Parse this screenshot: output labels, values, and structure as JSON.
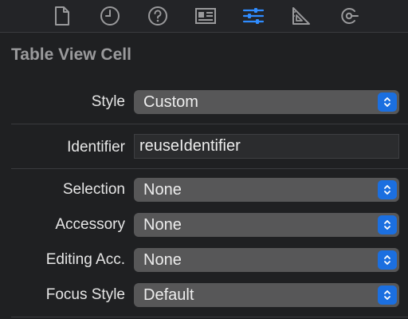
{
  "toolbar": {
    "icons": [
      {
        "name": "file-inspector-icon",
        "selected": false
      },
      {
        "name": "history-inspector-icon",
        "selected": false
      },
      {
        "name": "quick-help-icon",
        "selected": false
      },
      {
        "name": "identity-inspector-icon",
        "selected": false
      },
      {
        "name": "attributes-inspector-icon",
        "selected": true
      },
      {
        "name": "size-inspector-icon",
        "selected": false
      },
      {
        "name": "connections-inspector-icon",
        "selected": false
      }
    ],
    "accent_color": "#2f8cff"
  },
  "section": {
    "title": "Table View Cell"
  },
  "fields": {
    "style": {
      "label": "Style",
      "value": "Custom"
    },
    "identifier": {
      "label": "Identifier",
      "value": "reuseIdentifier"
    },
    "selection": {
      "label": "Selection",
      "value": "None"
    },
    "accessory": {
      "label": "Accessory",
      "value": "None"
    },
    "editing_acc": {
      "label": "Editing Acc.",
      "value": "None"
    },
    "focus_style": {
      "label": "Focus Style",
      "value": "Default"
    }
  },
  "colors": {
    "stepper_blue": "#1b6fe0",
    "popup_bg": "#575758",
    "panel_bg": "#1f2022"
  }
}
